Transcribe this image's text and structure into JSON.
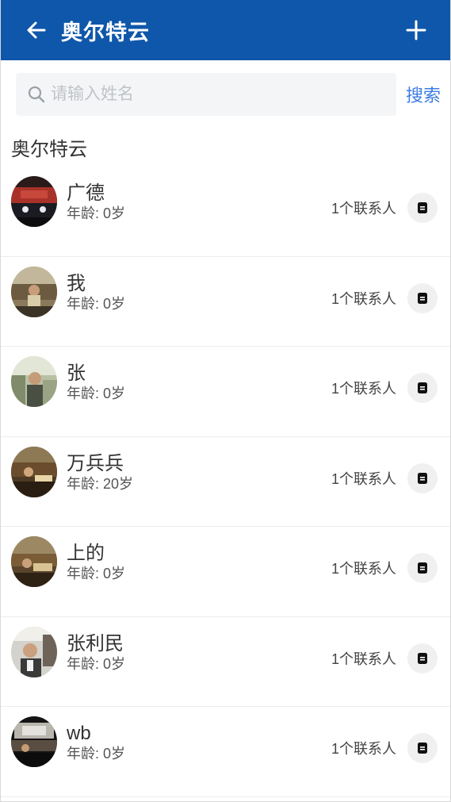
{
  "header": {
    "title": "奥尔特云"
  },
  "search": {
    "placeholder": "请输入姓名",
    "button_label": "搜索"
  },
  "group": {
    "title": "奥尔特云"
  },
  "members": [
    {
      "name": "广德",
      "age": "年龄: 0岁",
      "contacts": "1个联系人"
    },
    {
      "name": "我",
      "age": "年龄: 0岁",
      "contacts": "1个联系人"
    },
    {
      "name": "张",
      "age": "年龄: 0岁",
      "contacts": "1个联系人"
    },
    {
      "name": "万兵兵",
      "age": "年龄: 20岁",
      "contacts": "1个联系人"
    },
    {
      "name": "上的",
      "age": "年龄: 0岁",
      "contacts": "1个联系人"
    },
    {
      "name": "张利民",
      "age": "年龄: 0岁",
      "contacts": "1个联系人"
    },
    {
      "name": "wb",
      "age": "年龄: 0岁",
      "contacts": "1个联系人"
    }
  ],
  "colors": {
    "header": "#0f57aa",
    "link": "#3b7ce4"
  }
}
